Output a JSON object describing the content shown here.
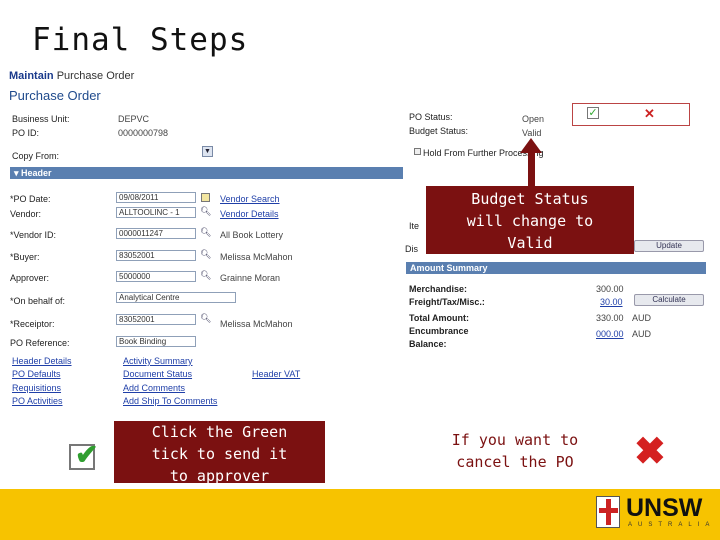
{
  "slide": {
    "title": "Final Steps"
  },
  "breadcrumb": {
    "part1": "Maintain",
    "part2": "Purchase Order"
  },
  "page_title": "Purchase Order",
  "header_fields": {
    "business_unit_label": "Business Unit:",
    "business_unit_value": "DEPVC",
    "po_id_label": "PO ID:",
    "po_id_value": "0000000798",
    "copy_from_label": "Copy From:",
    "po_status_label": "PO Status:",
    "po_status_value": "Open",
    "budget_status_label": "Budget Status:",
    "budget_status_value": "Valid",
    "hold_label": "Hold From Further Processing"
  },
  "header_section": {
    "label": "Header"
  },
  "header_form": {
    "po_date_label": "*PO Date:",
    "po_date_value": "09/08/2011",
    "vendor_search_link": "Vendor Search",
    "vendor_label": "Vendor:",
    "vendor_value": "ALLTOOLINC - 1",
    "vendor_details_link": "Vendor Details",
    "vendor_id_label": "*Vendor ID:",
    "vendor_id_value": "0000011247",
    "vendor_id_name": "All Book Lottery",
    "buyer_label": "*Buyer:",
    "buyer_value": "83052001",
    "buyer_name": "Melissa McMahon",
    "approver_label": "Approver:",
    "approver_value": "5000000",
    "approver_name": "Grainne Moran",
    "on_behalf_label": "*On behalf of:",
    "on_behalf_value": "Analytical Centre",
    "receiptor_label": "*Receiptor:",
    "receiptor_value": "83052001",
    "receiptor_name": "Melissa McMahon",
    "po_reference_label": "PO Reference:",
    "po_reference_value": "Book Binding",
    "currency_partial": "Dis",
    "item_partial": "Ite",
    "update_button": "Update"
  },
  "links": {
    "header_details": "Header Details",
    "po_defaults": "PO Defaults",
    "requisitions": "Requisitions",
    "po_activities": "PO Activities",
    "activity_summary": "Activity Summary",
    "document_status": "Document Status",
    "add_comments": "Add Comments",
    "add_ship_to_comments": "Add Ship To Comments",
    "header_vat": "Header VAT"
  },
  "amount_summary": {
    "title": "Amount Summary",
    "merchandise_label": "Merchandise:",
    "merchandise_value": "300.00",
    "freight_label": "Freight/Tax/Misc.:",
    "freight_value": "30.00",
    "total_label": "Total Amount:",
    "total_value": "330.00",
    "total_currency": "AUD",
    "encumbrance_label": "Encumbrance",
    "encumbrance_value": "000.00",
    "encumbrance_currency": "AUD",
    "balance_label": "Balance:",
    "calculate_button": "Calculate"
  },
  "callouts": {
    "budget_status": [
      "Budget Status",
      "will change to",
      "Valid"
    ],
    "green_tick": [
      "Click the Green",
      "tick to send it",
      "to approver"
    ],
    "cancel": [
      "If you want to",
      "cancel  the PO"
    ]
  },
  "logo": {
    "word": "UNSW",
    "sub": "AUSTRALIA"
  },
  "colors": {
    "callout_bg": "#7b1111",
    "footer": "#f7c300",
    "tick_green": "#2f9e2f",
    "cross_red": "#d42020"
  }
}
